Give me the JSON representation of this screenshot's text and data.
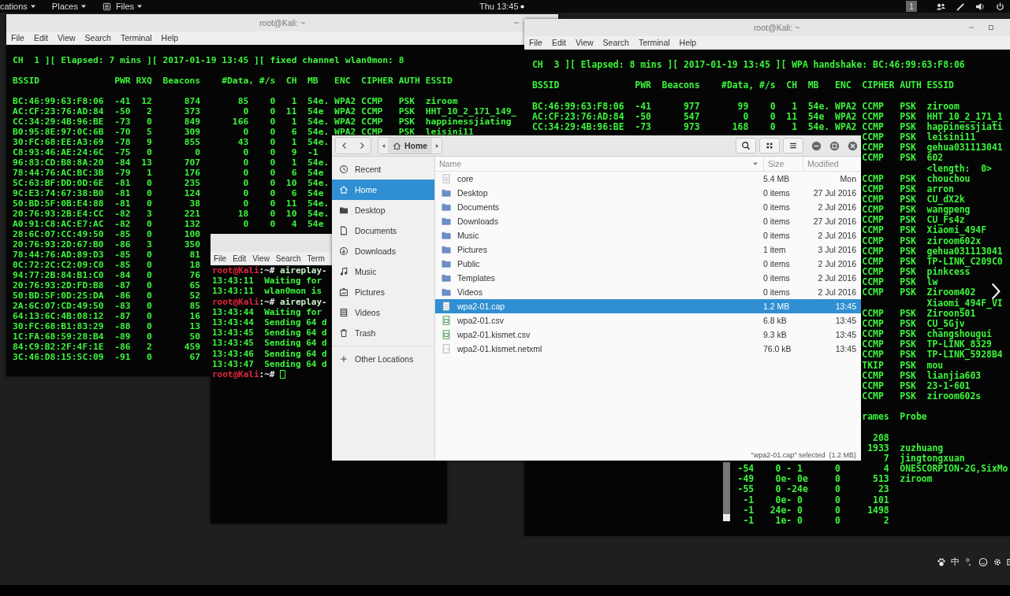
{
  "top_bar": {
    "applications_menu": "cations",
    "places_menu": "Places",
    "files_menu": "Files",
    "clock": "Thu 13:45",
    "workspace": "1"
  },
  "left_terminal": {
    "title": "root@Kali: ~",
    "menu": [
      "File",
      "Edit",
      "View",
      "Search",
      "Terminal",
      "Help"
    ],
    "status_line": "CH  1 ][ Elapsed: 7 mins ][ 2017-01-19 13:45 ][ fixed channel wlan0mon: 8",
    "header": "BSSID              PWR RXQ  Beacons    #Data, #/s  CH  MB   ENC  CIPHER AUTH ESSID",
    "rows": [
      "BC:46:99:63:F8:06  -41  12      874       85    0   1  54e. WPA2 CCMP   PSK  ziroom",
      "AC:CF:23:76:AD:84  -50   2      373        0    0  11  54e  WPA2 CCMP   PSK  HHT_10_2_171_149_",
      "CC:34:29:4B:96:BE  -73   0      849      166    0   1  54e. WPA2 CCMP   PSK  happinessjiating",
      "B0:95:8E:97:0C:6B  -70   5      309        0    0   6  54e. WPA2 CCMP   PSK  leisini11",
      "30:FC:68:EE:A3:69  -78   9      855       43    0   1  54e.",
      "C8:93:46:AE:24:6C  -75   0        0        0    0   9  -1",
      "96:83:CD:B8:8A:20  -84  13      707        0    0   1  54e.",
      "78:44:76:AC:BC:3B  -79   1      176        0    0   6  54e",
      "5C:63:BF:DD:0D:6E  -81   0      235        0    0  10  54e.",
      "9C:E3:74:67:38:B0  -81   0      124        0    0   6  54e",
      "50:BD:5F:0B:E4:88  -81   0       38        0    0  11  54e.",
      "20:76:93:2B:E4:CC  -82   3      221       18    0  10  54e.",
      "A0:91:C8:AC:E7:AC  -82   0      132        0    0   4  54e",
      "28:6C:07:CC:49:50  -85   0      100",
      "20:76:93:2D:67:B0  -86   3      350",
      "78:44:76:AD:89:D3  -85   0       81",
      "0C:72:2C:C2:09:C0  -85   0       18",
      "94:77:2B:84:B1:C0  -84   0       76",
      "20:76:93:2D:FD:B8  -87   0       65",
      "50:BD:5F:0D:25:DA  -86   0       52",
      "2A:6C:07:CD:49:50  -83   0       85",
      "64:13:6C:4B:08:12  -87   0       16",
      "30:FC:68:B1:83:29  -88   0       13",
      "1C:FA:68:59:28:B4  -89   0       50",
      "84:C9:B2:2F:4F:1E  -86   2      459",
      "3C:46:D8:15:5C:09  -91   0       67"
    ]
  },
  "right_terminal": {
    "title": "root@Kali: ~",
    "menu": [
      "File",
      "Edit",
      "View",
      "Search",
      "Terminal",
      "Help"
    ],
    "status_line": "CH  3 ][ Elapsed: 8 mins ][ 2017-01-19 13:45 ][ WPA handshake: BC:46:99:63:F8:06",
    "header": "BSSID              PWR  Beacons    #Data, #/s  CH  MB   ENC  CIPHER AUTH ESSID",
    "rows": [
      "BC:46:99:63:F8:06  -41      977       99    0   1  54e. WPA2 CCMP   PSK  ziroom",
      "AC:CF:23:76:AD:84  -50      547        0    0  11  54e  WPA2 CCMP   PSK  HHT_10_2_171_1",
      "CC:34:29:4B:96:BE  -73      973      168    0   1  54e. WPA2 CCMP   PSK  happinessjiati"
    ],
    "rows_right_part": [
      "CCMP   PSK  leisini11",
      "CCMP   PSK  gehua031113041",
      "CCMP   PSK  602",
      "            <length:  0>",
      "CCMP   PSK  chouchou",
      "CCMP   PSK  arron",
      "CCMP   PSK  CU_dX2k",
      "CCMP   PSK  wangpeng",
      "CCMP   PSK  CU_Fs4z",
      "CCMP   PSK  Xiaomi_494F",
      "CCMP   PSK  ziroom602x",
      "CCMP   PSK  gehua031113041",
      "CCMP   PSK  TP-LINK_C209C0",
      "CCMP   PSK  pinkcess",
      "CCMP   PSK  lw",
      "CCMP   PSK  Ziroom402",
      "            Xiaomi_494F_VI",
      "CCMP   PSK  Ziroon501",
      "CCMP   PSK  CU_5Gjv",
      "CCMP   PSK  changshougui",
      "CCMP   PSK  TP-LINK_8329",
      "CCMP   PSK  TP-LINK_5928B4",
      "TKIP   PSK  mou",
      "CCMP   PSK  lianjia603",
      "CCMP   PSK  23-1-601",
      "CCMP   PSK  ziroom602s"
    ],
    "station_header_part": "rames  Probe",
    "station_rows_right_part": [
      "  208",
      " 1933  zuzhuang",
      "    7  jingtongxuan"
    ],
    "station_rows_lower_part": [
      "-54    0 - 1      0        4  ONESCORPION-2G,SixMo",
      "-49    0e- 0e     0      513  ziroom",
      "-55    0 -24e     0       23",
      " -1    0e- 0      0      101",
      " -1   24e- 0      0     1498",
      " -1    1e- 0      0        2"
    ]
  },
  "small_terminal": {
    "menu": [
      "File",
      "Edit",
      "View",
      "Search",
      "Term"
    ],
    "lines": [
      {
        "kind": "prompt",
        "user": "root@Kali",
        "path": ":~#",
        "command": "aireplay-",
        "cursor": false
      },
      {
        "kind": "output",
        "text": "13:43:11  Waiting for"
      },
      {
        "kind": "output",
        "text": "13:43:11  wlan0mon is"
      },
      {
        "kind": "prompt",
        "user": "root@Kali",
        "path": ":~#",
        "command": "aireplay-",
        "cursor": false
      },
      {
        "kind": "output",
        "text": "13:43:44  Waiting for"
      },
      {
        "kind": "output",
        "text": "13:43:44  Sending 64 d"
      },
      {
        "kind": "output",
        "text": "13:43:45  Sending 64 d"
      },
      {
        "kind": "output",
        "text": "13:43:45  Sending 64 d"
      },
      {
        "kind": "output",
        "text": "13:43:46  Sending 64 d"
      },
      {
        "kind": "output",
        "text": "13:43:47  Sending 64 d"
      },
      {
        "kind": "prompt",
        "user": "root@Kali",
        "path": ":~#",
        "cursor": true
      }
    ]
  },
  "file_manager": {
    "location": "Home",
    "sidebar": [
      {
        "label": "Recent",
        "selected": false
      },
      {
        "label": "Home",
        "selected": true
      },
      {
        "label": "Desktop",
        "selected": false
      },
      {
        "label": "Documents",
        "selected": false
      },
      {
        "label": "Downloads",
        "selected": false
      },
      {
        "label": "Music",
        "selected": false
      },
      {
        "label": "Pictures",
        "selected": false
      },
      {
        "label": "Videos",
        "selected": false
      },
      {
        "label": "Trash",
        "selected": false
      }
    ],
    "other_locations": "Other Locations",
    "columns": [
      "Name",
      "Size",
      "Modified"
    ],
    "files": [
      {
        "name": "core",
        "size": "5.4 MB",
        "modified": "Mon",
        "kind": "file",
        "selected": false
      },
      {
        "name": "Desktop",
        "size": "0 items",
        "modified": "27 Jul 2016",
        "kind": "folder",
        "selected": false
      },
      {
        "name": "Documents",
        "size": "0 items",
        "modified": "2 Jul 2016",
        "kind": "folder",
        "selected": false
      },
      {
        "name": "Downloads",
        "size": "0 items",
        "modified": "27 Jul 2016",
        "kind": "folder",
        "selected": false
      },
      {
        "name": "Music",
        "size": "0 items",
        "modified": "2 Jul 2016",
        "kind": "folder",
        "selected": false
      },
      {
        "name": "Pictures",
        "size": "1 item",
        "modified": "3 Jul 2016",
        "kind": "folder",
        "selected": false
      },
      {
        "name": "Public",
        "size": "0 items",
        "modified": "2 Jul 2016",
        "kind": "folder",
        "selected": false
      },
      {
        "name": "Templates",
        "size": "0 items",
        "modified": "2 Jul 2016",
        "kind": "folder",
        "selected": false
      },
      {
        "name": "Videos",
        "size": "0 items",
        "modified": "2 Jul 2016",
        "kind": "folder",
        "selected": false
      },
      {
        "name": "wpa2-01.cap",
        "size": "1.2 MB",
        "modified": "13:45",
        "kind": "file",
        "selected": true
      },
      {
        "name": "wpa2-01.csv",
        "size": "6.8 kB",
        "modified": "13:45",
        "kind": "sheet",
        "selected": false
      },
      {
        "name": "wpa2-01.kismet.csv",
        "size": "9.3 kB",
        "modified": "13:45",
        "kind": "sheet",
        "selected": false
      },
      {
        "name": "wpa2-01.kismet.netxml",
        "size": "76.0 kB",
        "modified": "13:45",
        "kind": "markup",
        "selected": false
      }
    ],
    "status": "\"wpa2-01.cap\" selected  (1.2 MB)"
  },
  "tray": {
    "input_method": "中"
  }
}
